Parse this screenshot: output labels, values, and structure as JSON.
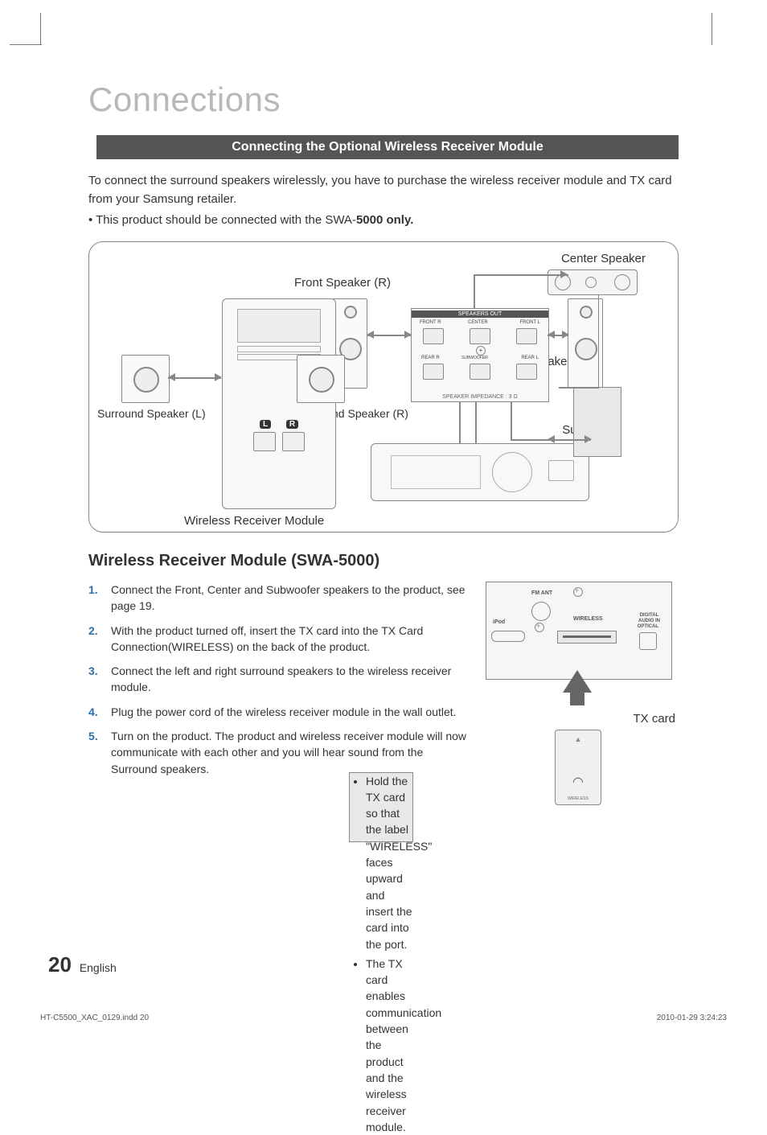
{
  "page_title": "Connections",
  "banner": "Connecting the Optional Wireless Receiver Module",
  "intro": "To connect the surround speakers wirelessly, you have to purchase the wireless receiver module and TX card from your Samsung retailer.",
  "intro_bullet_prefix": "• This product should be connected with the SWA-",
  "intro_bullet_bold": "5000 only.",
  "diagram_labels": {
    "center_speaker": "Center Speaker",
    "front_speaker_r": "Front Speaker (R)",
    "front_speaker_l": "Front Speaker (L)",
    "surround_l": "Surround Speaker (L)",
    "surround_r": "Surround Speaker (R)",
    "subwoofer": "Subwoofer",
    "wireless_receiver": "Wireless Receiver Module",
    "speakers_out": "SPEAKERS OUT",
    "impedance": "SPEAKER IMPEDANCE : 3 Ω",
    "front_r_port": "FRONT R",
    "center_port": "CENTER",
    "front_l_port": "FRONT L",
    "rear_r_port": "REAR R",
    "sub_port": "SUBWOOFER",
    "rear_l_port": "REAR L",
    "L": "L",
    "R": "R"
  },
  "section_heading": "Wireless Receiver Module (SWA-5000)",
  "steps": [
    {
      "text": "Connect the Front, Center and Subwoofer speakers to the product, see page 19.",
      "sub": []
    },
    {
      "text": "With the product turned off, insert the TX card into the TX Card Connection(WIRELESS) on the back of the product.",
      "sub": [
        "Hold the TX card so that the label \"WIRELESS\" faces upward and insert the card into the port.",
        "The TX card enables communication between the product and the wireless receiver module."
      ]
    },
    {
      "text": "Connect the left and right surround speakers to the wireless receiver module.",
      "sub": []
    },
    {
      "text": "Plug the power cord of the wireless receiver module in the wall outlet.",
      "sub": []
    },
    {
      "text": "Turn on the product. The product and wireless receiver module will now communicate with each other and you will hear sound from the Surround speakers.",
      "sub": []
    }
  ],
  "side_diagram": {
    "fm_ant": "FM ANT",
    "ipod": "iPod",
    "wireless": "WIRELESS",
    "digital_audio_in": "DIGITAL\nAUDIO IN",
    "optical": "OPTICAL",
    "tx_card": "TX card",
    "tx_card_small": "WIRELESS"
  },
  "footer": {
    "page_number": "20",
    "language": "English"
  },
  "printer": {
    "file": "HT-C5500_XAC_0129.indd   20",
    "datetime": "2010-01-29   3:24:23"
  }
}
